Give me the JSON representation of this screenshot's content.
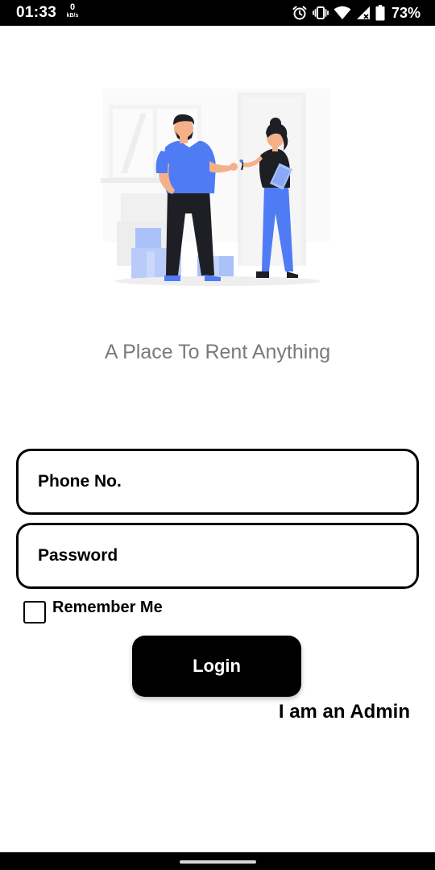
{
  "status_bar": {
    "time": "01:33",
    "net_speed_value": "0",
    "net_speed_unit": "kB/s",
    "battery_percent": "73%",
    "icons": [
      "alarm-icon",
      "vibrate-icon",
      "wifi-icon",
      "cell-signal-icon",
      "battery-icon"
    ]
  },
  "illustration": {
    "description_icon": "people-handing-keys-illustration",
    "colors": {
      "accent_blue": "#4f7bf5",
      "light_blue": "#a9c1f8",
      "dark": "#1e1f24",
      "skin": "#f4b089",
      "background_gray": "#f2f2f2"
    }
  },
  "tagline": "A Place To Rent Anything",
  "form": {
    "phone_placeholder": "Phone No.",
    "password_placeholder": "Password",
    "remember_label": "Remember Me",
    "remember_checked": false,
    "login_label": "Login",
    "admin_link": "I am an Admin"
  }
}
